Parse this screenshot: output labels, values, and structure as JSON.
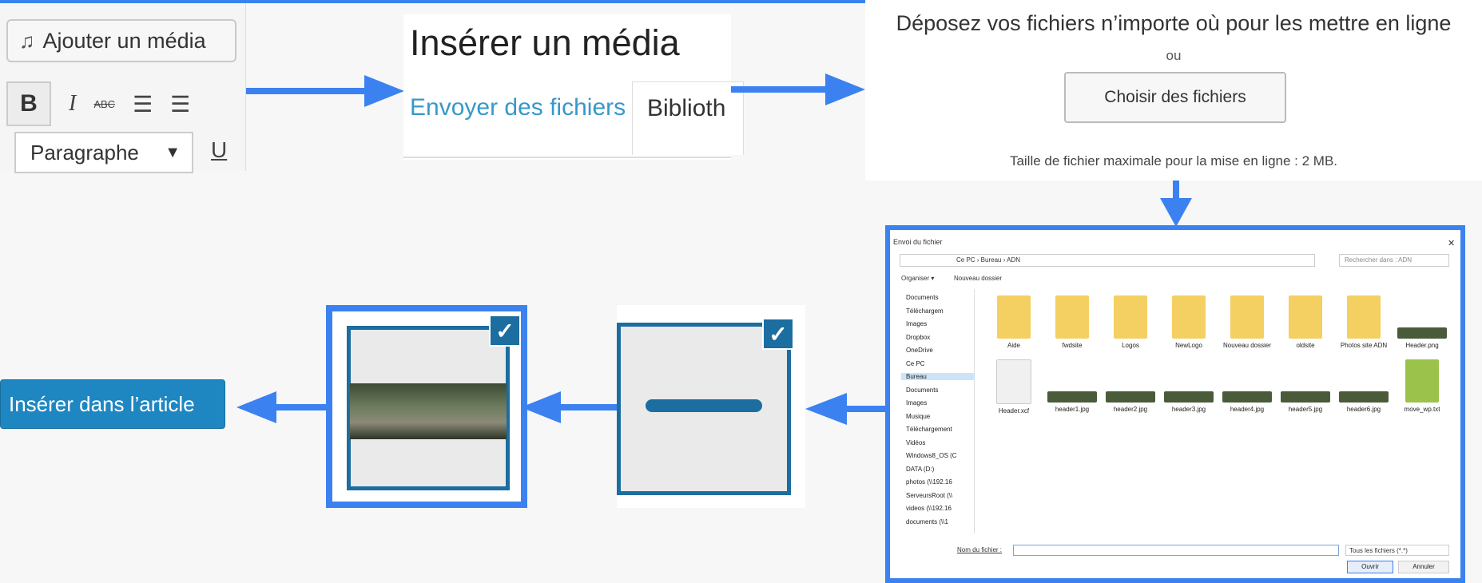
{
  "editor": {
    "add_media_label": "Ajouter un média",
    "bold_label": "B",
    "italic_label": "I",
    "strike_label": "ABC",
    "format_select": "Paragraphe",
    "underline_label": "U"
  },
  "insert_media": {
    "title": "Insérer un média",
    "tab_upload": "Envoyer des fichiers",
    "tab_library": "Biblioth"
  },
  "upload": {
    "drop_text": "Déposez vos fichiers n’importe où pour les mettre en ligne",
    "or": "ou",
    "choose_button": "Choisir des fichiers",
    "max_size": "Taille de fichier maximale pour la mise en ligne : 2 MB."
  },
  "file_dialog": {
    "title": "Envoi du fichier",
    "path": "Ce PC  ›  Bureau  ›  ADN",
    "search_placeholder": "Rechercher dans : ADN",
    "organize": "Organiser ▾",
    "new_folder": "Nouveau dossier",
    "nav": [
      "Documents",
      "Téléchargem",
      "Images",
      "Dropbox",
      "OneDrive",
      "Ce PC",
      "Bureau",
      "Documents",
      "Images",
      "Musique",
      "Téléchargement",
      "Vidéos",
      "Windows8_OS (C",
      "DATA (D:)",
      "photos (\\\\192.16",
      "ServeursRoot (\\\\",
      "videos (\\\\192.16",
      "documents (\\\\1"
    ],
    "files": [
      "Aide",
      "fwdsite",
      "Logos",
      "NewLogo",
      "Nouveau dossier",
      "oldsite",
      "Photos site ADN",
      "Header.png",
      "Header.xcf",
      "header1.jpg",
      "header2.jpg",
      "header3.jpg",
      "header4.jpg",
      "header5.jpg",
      "header6.jpg",
      "move_wp.txt"
    ],
    "filename_label": "Nom du fichier :",
    "filetype": "Tous les fichiers (*.*)",
    "open_button": "Ouvrir",
    "cancel_button": "Annuler"
  },
  "insert_button": "Insérer dans l’article",
  "colors": {
    "accent": "#3b82f0",
    "wp_blue": "#1e87c2",
    "select_blue": "#1c6da0"
  }
}
